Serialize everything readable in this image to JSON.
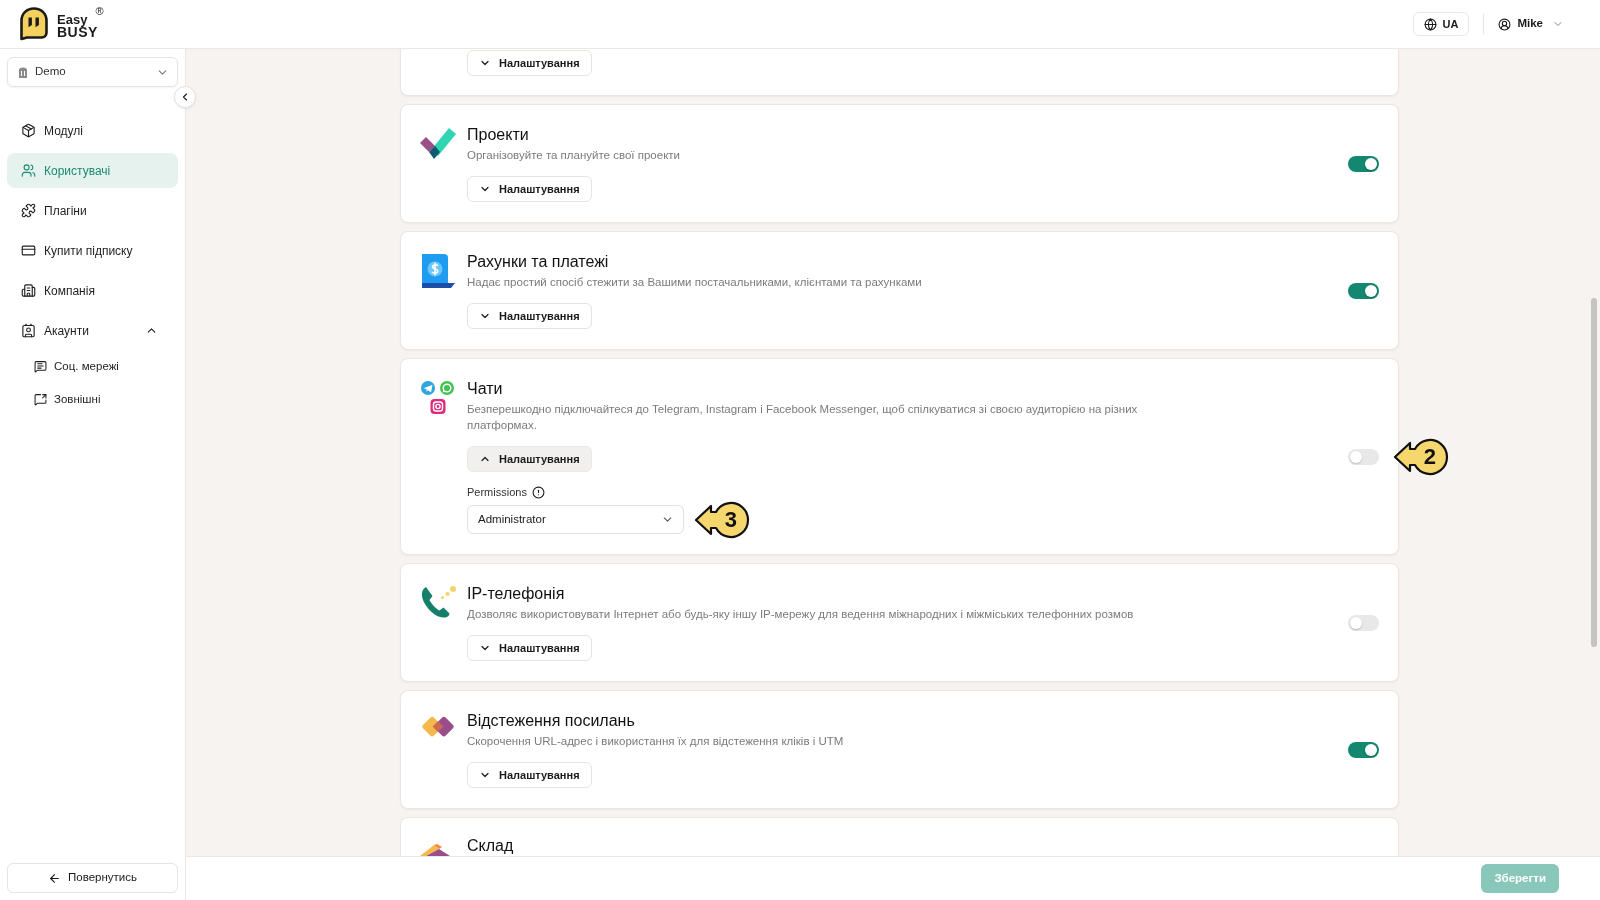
{
  "header": {
    "logo": {
      "top_word": "Easy",
      "bottom_word": "BUSY",
      "registered_mark": "®"
    },
    "language_button": "UA",
    "user_menu": "Mike"
  },
  "sidebar": {
    "workspace_select": "Demo",
    "nav_items": [
      {
        "kind": "link",
        "label": "Модулі",
        "selected": false
      },
      {
        "kind": "link",
        "label": "Користувачі",
        "selected": true
      },
      {
        "kind": "link",
        "label": "Плагіни",
        "selected": false
      },
      {
        "kind": "link",
        "label": "Купити підписку",
        "selected": false
      },
      {
        "kind": "link",
        "label": "Компанія",
        "selected": false
      },
      {
        "kind": "group",
        "label": "Акаунти",
        "selected": false,
        "expanded": true,
        "children": [
          {
            "label": "Соц. мережі",
            "selected": false
          },
          {
            "label": "Зовнішні",
            "selected": false
          }
        ]
      }
    ],
    "back_button": "Повернутись"
  },
  "modules": [
    {
      "kind": "cut_top",
      "settings_button": "Налаштування",
      "expanded": false
    },
    {
      "kind": "full",
      "title": "Проекти",
      "description": "Організовуйте та плануйте свої проекти",
      "settings_button": "Налаштування",
      "expanded": false,
      "on": true
    },
    {
      "kind": "full",
      "title": "Рахунки та платежі",
      "description": "Надає простий спосіб стежити за Вашими постачальниками, клієнтами та рахунками",
      "settings_button": "Налаштування",
      "expanded": false,
      "on": true
    },
    {
      "kind": "full",
      "title": "Чати",
      "description": "Безперешкодно підключайтеся до Telegram, Instagram і Facebook Messenger, щоб спілкуватися зі своєю аудиторією на різних платформах.",
      "settings_button": "Налаштування",
      "expanded": true,
      "on": false,
      "toggle_callout": "2",
      "permissions": {
        "label": "Permissions",
        "value": "Administrator",
        "callout": "3"
      }
    },
    {
      "kind": "full",
      "title": "IP-телефонія",
      "description": "Дозволяє використовувати Інтернет або будь-яку іншу IP-мережу для ведення міжнародних і міжміських телефонних розмов",
      "settings_button": "Налаштування",
      "expanded": false,
      "on": false
    },
    {
      "kind": "full",
      "title": "Відстеження посилань",
      "description": "Скорочення URL-адрес і використання їх для відстеження кліків і UTM",
      "settings_button": "Налаштування",
      "expanded": false,
      "on": true
    },
    {
      "kind": "cut_bottom",
      "title": "Склад"
    }
  ],
  "footer": {
    "save_button": {
      "label": "Зберегти",
      "disabled": true
    }
  }
}
